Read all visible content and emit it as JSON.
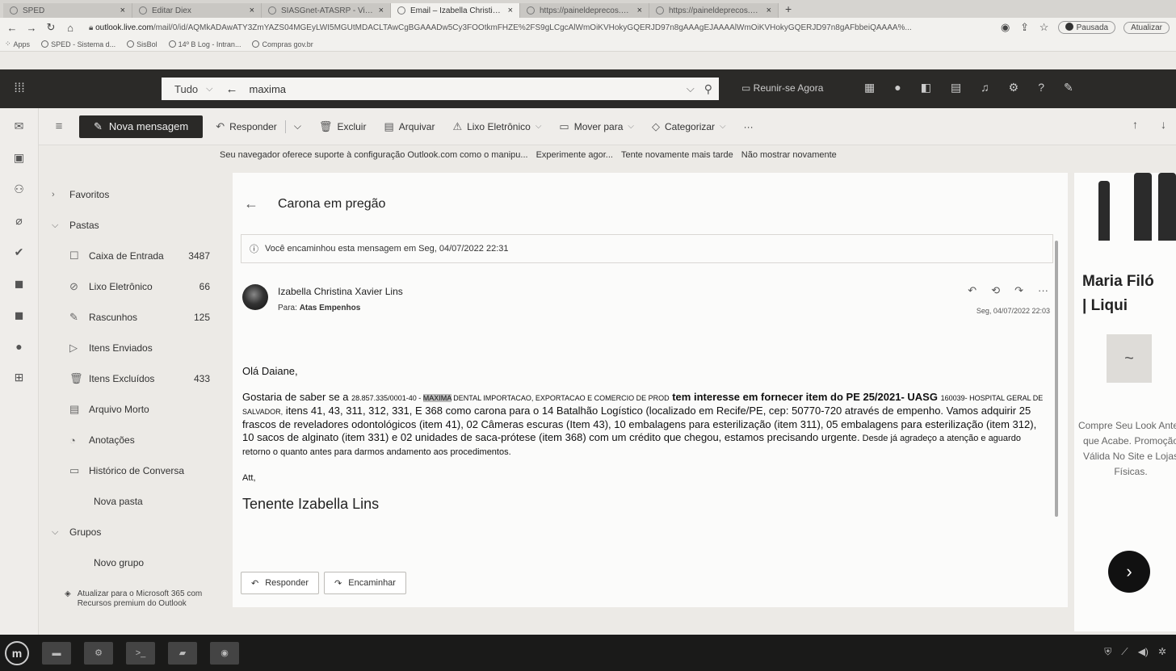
{
  "browser": {
    "tabs": [
      {
        "title": "SPED",
        "active": false
      },
      {
        "title": "Editar Diex",
        "active": false
      },
      {
        "title": "SIASGnet-ATASRP - Visualiza",
        "active": false
      },
      {
        "title": "Email – Izabella Christina Xav",
        "active": true
      },
      {
        "title": "https://paineldeprecos.plane",
        "active": false
      },
      {
        "title": "https://paineldeprecos.plan",
        "active": false
      }
    ],
    "new_tab": "+",
    "url_host": "outlook.live.com",
    "url_path": "/mail/0/id/AQMkADAwATY3ZmYAZS04MGEyLWI5MGUtMDACLTAwCgBGAAADw5Cy3FOOtkmFHZE%2FS9gLCgcAlWmOiKVHokyGQERJD97n8gAAAgEJAAAAlWmOiKVHokyGQERJD97n8gAFbbeiQAAAA%...",
    "profile_label": "Pausada",
    "update_label": "Atualizar",
    "bookmarks": [
      "Apps",
      "SPED - Sistema d...",
      "SisBol",
      "14º B Log - Intran...",
      "Compras gov.br"
    ]
  },
  "outlook_top": {
    "search_scope": "Tudo",
    "search_query": "maxima",
    "meet_now": "Reunir-se Agora"
  },
  "commands": {
    "new_message": "Nova mensagem",
    "reply": "Responder",
    "delete": "Excluir",
    "archive": "Arquivar",
    "junk": "Lixo Eletrônico",
    "move": "Mover para",
    "categorize": "Categorizar",
    "more": "···"
  },
  "notice": {
    "text": "Seu navegador oferece suporte à configuração Outlook.com como o manipu...",
    "try_now": "Experimente agor...",
    "later": "Tente novamente mais tarde",
    "dont_show": "Não mostrar novamente"
  },
  "folders": {
    "favorites": "Favoritos",
    "folders_section": "Pastas",
    "items": [
      {
        "label": "Caixa de Entrada",
        "count": "3487",
        "icon": "inbox-icon"
      },
      {
        "label": "Lixo Eletrônico",
        "count": "66",
        "icon": "junk-icon"
      },
      {
        "label": "Rascunhos",
        "count": "125",
        "icon": "drafts-icon"
      },
      {
        "label": "Itens Enviados",
        "count": "",
        "icon": "sent-icon"
      },
      {
        "label": "Itens Excluídos",
        "count": "433",
        "icon": "trash-icon"
      },
      {
        "label": "Arquivo Morto",
        "count": "",
        "icon": "archive-icon"
      },
      {
        "label": "Anotações",
        "count": "",
        "icon": "notes-icon"
      },
      {
        "label": "Histórico de Conversa",
        "count": "",
        "icon": "history-icon"
      }
    ],
    "new_folder": "Nova pasta",
    "groups": "Grupos",
    "new_group": "Novo grupo",
    "upgrade": "Atualizar para o Microsoft 365 com Recursos premium do Outlook"
  },
  "message": {
    "subject": "Carona em pregão",
    "forwarded_notice": "Você encaminhou esta mensagem em Seg, 04/07/2022 22:31",
    "sender": "Izabella Christina Xavier Lins",
    "to_label": "Para:",
    "to_value": "Atas Empenhos",
    "date": "Seg, 04/07/2022 22:03",
    "greeting": "Olá Daiane,",
    "body_1": "Gostaria de saber se  a ",
    "company_cnpj": "28.857.335/0001-40 - ",
    "company_highlight": "MAXIMA",
    "company_rest": " DENTAL IMPORTACAO, EXPORTACAO E COMERCIO DE PROD",
    "body_2": " tem interesse em fornecer item do PE 25/2021- UASG ",
    "uasg_small": "160039- HOSPITAL GERAL DE SALVADOR,",
    "body_3": " itens 41, 43, 311, 312, 331, E 368 como carona para o 14 Batalhão Logístico (localizado em Recife/PE, cep: 50770-720 através de empenho. Vamos adquirir 25 frascos de reveladores odontológicos (item 41), 02 Câmeras escuras (Item 43),  10 embalagens para esterilização (item 311), 05 embalagens para esterilização (item 312), 10 sacos de alginato (item 331) e 02 unidades de saca-prótese (item 368)  com um crédito que chegou, estamos precisando urgente.",
    "body_4": " Desde já agradeço a atenção e aguardo retorno o quanto antes para darmos andamento aos procedimentos.",
    "closing": "Att,",
    "signature": "Tenente Izabella Lins",
    "reply_button": "Responder",
    "forward_button": "Encaminhar"
  },
  "ad": {
    "title_line1": "Maria Filó",
    "title_line2": "| Liqui",
    "text": "Compre Seu Look Antes que Acabe. Promoção Válida No Site e Lojas Físicas."
  }
}
